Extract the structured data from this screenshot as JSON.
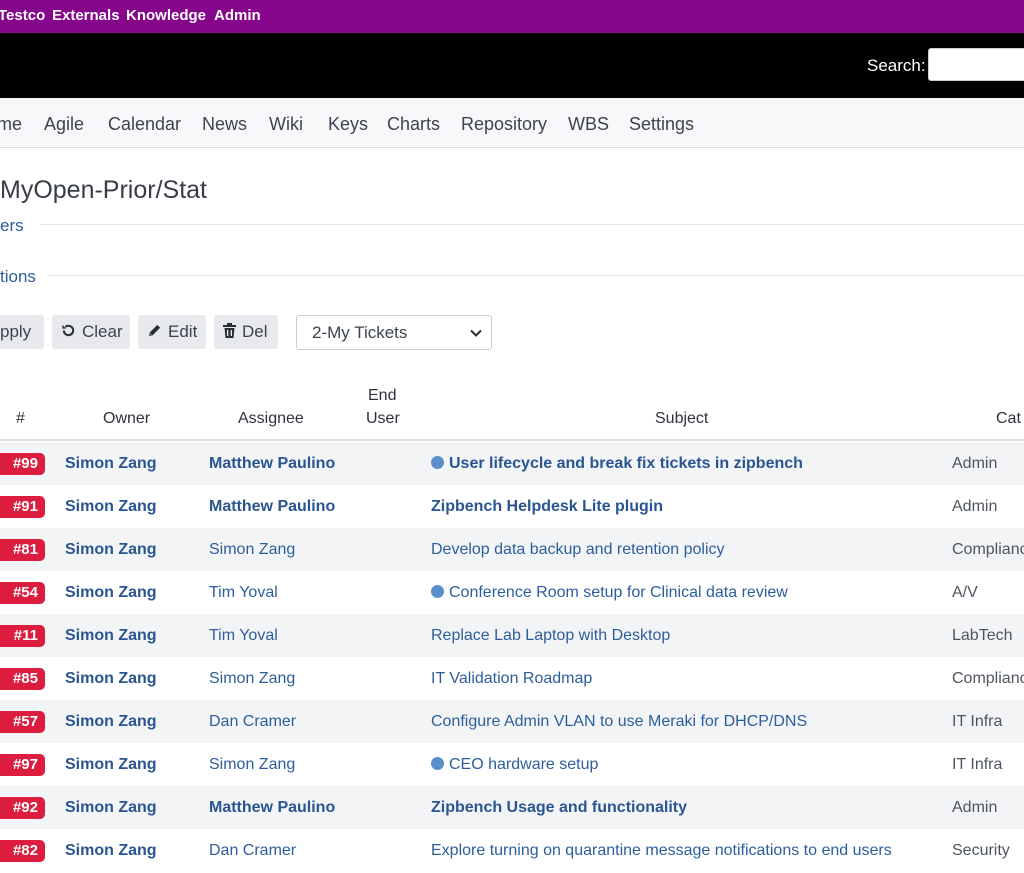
{
  "topnav": [
    "Testco",
    "Externals",
    "Knowledge",
    "Admin"
  ],
  "header": {
    "search_label": "Search:",
    "search_value": ""
  },
  "tabs": [
    "me",
    "Agile",
    "Calendar",
    "News",
    "Wiki",
    "Keys",
    "Charts",
    "Repository",
    "WBS",
    "Settings"
  ],
  "page": {
    "title": "MyOpen-Prior/Stat",
    "filters_link": "ers",
    "options_link": "tions"
  },
  "toolbar": {
    "apply": "pply",
    "clear": "Clear",
    "edit": "Edit",
    "del": "Del",
    "query_select": "2-My Tickets"
  },
  "table": {
    "headers": {
      "num": "#",
      "owner": "Owner",
      "assignee": "Assignee",
      "end_user_line1": "End",
      "end_user_line2": "User",
      "subject": "Subject",
      "category": "Cat"
    },
    "rows": [
      {
        "id": "#99",
        "owner": "Simon Zang",
        "assignee": "Matthew Paulino",
        "assignee_bold": true,
        "subject": "User lifecycle and break fix tickets in zipbench",
        "subject_bold": true,
        "dot": true,
        "category": "Admin"
      },
      {
        "id": "#91",
        "owner": "Simon Zang",
        "assignee": "Matthew Paulino",
        "assignee_bold": true,
        "subject": "Zipbench Helpdesk Lite plugin",
        "subject_bold": true,
        "dot": false,
        "category": "Admin"
      },
      {
        "id": "#81",
        "owner": "Simon Zang",
        "assignee": "Simon Zang",
        "assignee_bold": false,
        "subject": "Develop data backup and retention policy",
        "subject_bold": false,
        "dot": false,
        "category": "Complianc"
      },
      {
        "id": "#54",
        "owner": "Simon Zang",
        "assignee": "Tim Yoval",
        "assignee_bold": false,
        "subject": "Conference Room setup for Clinical data review",
        "subject_bold": false,
        "dot": true,
        "category": "A/V"
      },
      {
        "id": "#11",
        "owner": "Simon Zang",
        "assignee": "Tim Yoval",
        "assignee_bold": false,
        "subject": "Replace Lab Laptop with Desktop",
        "subject_bold": false,
        "dot": false,
        "category": "LabTech"
      },
      {
        "id": "#85",
        "owner": "Simon Zang",
        "assignee": "Simon Zang",
        "assignee_bold": false,
        "subject": "IT Validation Roadmap",
        "subject_bold": false,
        "dot": false,
        "category": "Complianc"
      },
      {
        "id": "#57",
        "owner": "Simon Zang",
        "assignee": "Dan Cramer",
        "assignee_bold": false,
        "subject": "Configure Admin VLAN to use Meraki for DHCP/DNS",
        "subject_bold": false,
        "dot": false,
        "category": "IT Infra"
      },
      {
        "id": "#97",
        "owner": "Simon Zang",
        "assignee": "Simon Zang",
        "assignee_bold": false,
        "subject": "CEO hardware setup",
        "subject_bold": false,
        "dot": true,
        "category": "IT Infra"
      },
      {
        "id": "#92",
        "owner": "Simon Zang",
        "assignee": "Matthew Paulino",
        "assignee_bold": true,
        "subject": "Zipbench Usage and functionality",
        "subject_bold": true,
        "dot": false,
        "category": "Admin"
      },
      {
        "id": "#82",
        "owner": "Simon Zang",
        "assignee": "Dan Cramer",
        "assignee_bold": false,
        "subject": "Explore turning on quarantine message notifications to end users",
        "subject_bold": false,
        "dot": false,
        "category": "Security"
      }
    ]
  },
  "colors": {
    "topbar": "#85068a",
    "header": "#000000",
    "badge": "#dc1d3f",
    "link": "#2d5e9c",
    "dot": "#5b8fcc"
  }
}
